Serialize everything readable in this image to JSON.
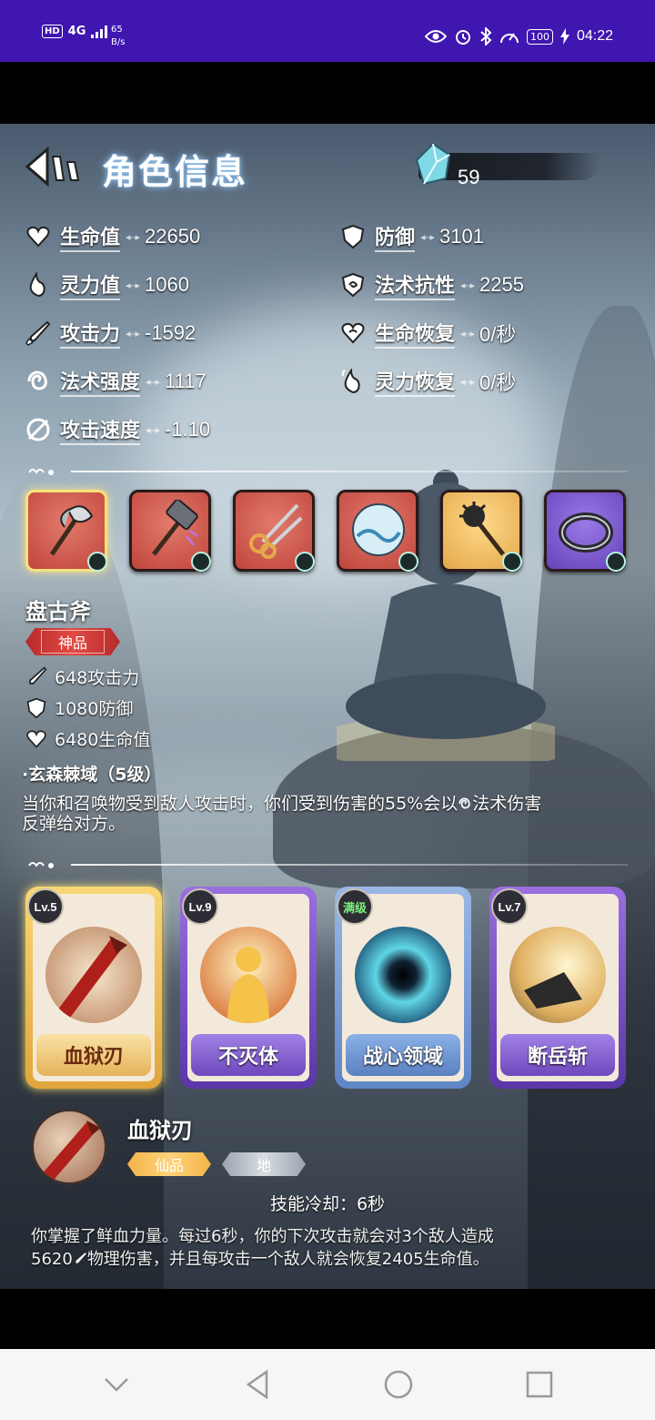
{
  "status_bar": {
    "hd": "HD",
    "network": "4G",
    "speed_value": "65",
    "speed_unit": "B/s",
    "battery": "100",
    "time": "04:22"
  },
  "header": {
    "title": "角色信息",
    "gem_count": "59"
  },
  "stats": [
    {
      "icon": "heart-icon",
      "label": "生命值",
      "value": "22650"
    },
    {
      "icon": "shield-icon",
      "label": "防御",
      "value": "3101"
    },
    {
      "icon": "flame-icon",
      "label": "灵力值",
      "value": "1060"
    },
    {
      "icon": "magic-shield-icon",
      "label": "法术抗性",
      "value": "2255"
    },
    {
      "icon": "sword-icon",
      "label": "攻击力",
      "value": "-1592"
    },
    {
      "icon": "heart-regen-icon",
      "label": "生命恢复",
      "value": "0/秒"
    },
    {
      "icon": "spiral-icon",
      "label": "法术强度",
      "value": "1117"
    },
    {
      "icon": "flame-regen-icon",
      "label": "灵力恢复",
      "value": "0/秒"
    },
    {
      "icon": "attack-speed-icon",
      "label": "攻击速度",
      "value": "-1.10"
    }
  ],
  "equipment": [
    {
      "name": "axe-icon",
      "rarity": "red"
    },
    {
      "name": "hammer-icon",
      "rarity": "red"
    },
    {
      "name": "scissors-icon",
      "rarity": "red"
    },
    {
      "name": "orb-icon",
      "rarity": "red"
    },
    {
      "name": "mace-icon",
      "rarity": "gold"
    },
    {
      "name": "ring-icon",
      "rarity": "purple"
    }
  ],
  "selected_item": {
    "name": "盘古斧",
    "grade": "神品",
    "stats": [
      "648攻击力",
      "1080防御",
      "6480生命值"
    ],
    "skill_title": "·玄森棘域（5级）",
    "skill_desc_a": "当你和召唤物受到敌人攻击时，你们受到伤害的55%会以",
    "skill_desc_b": "法术伤害",
    "skill_desc_c": "反弹给对方。"
  },
  "skills": [
    {
      "level": "Lv.5",
      "name": "血狱刃",
      "frame": "gold"
    },
    {
      "level": "Lv.9",
      "name": "不灭体",
      "frame": "purple"
    },
    {
      "level": "满级",
      "name": "战心领域",
      "frame": "blue"
    },
    {
      "level": "Lv.7",
      "name": "断岳斩",
      "frame": "purple"
    }
  ],
  "skill_detail": {
    "name": "血狱刃",
    "tag1": "仙品",
    "tag2": "地",
    "cooldown": "技能冷却：6秒",
    "desc_line1": "你掌握了鲜血力量。每过6秒，你的下次攻击就会对3个敌人造成",
    "desc_num": "5620",
    "desc_line2": "物理伤害，并且每攻击一个敌人就会恢复2405生命值。"
  },
  "colors": {
    "status_bar": "#3f16b0",
    "grade_red": "#e24a44",
    "tag_gold": "#ffd27a"
  }
}
